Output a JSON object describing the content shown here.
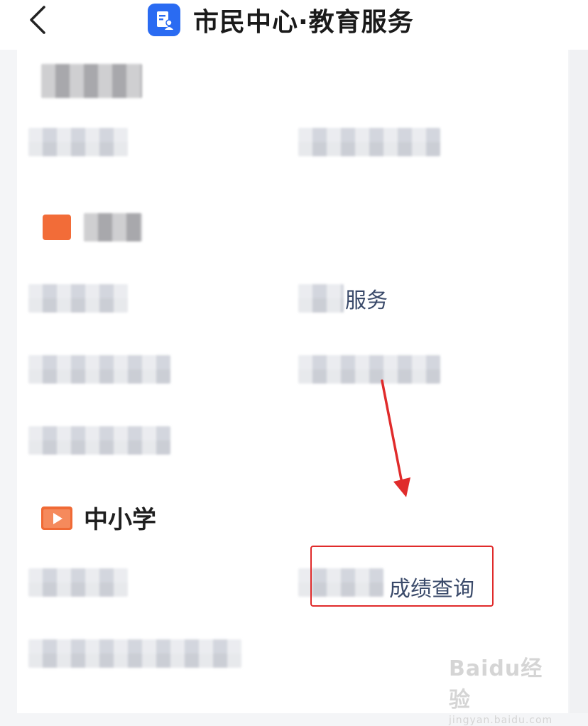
{
  "header": {
    "title": "市民中心·教育服务",
    "back_icon": "chevron-left-icon",
    "app_icon": "document-person-icon",
    "app_icon_color": "#2a6bf2"
  },
  "sections": {
    "section3": {
      "title": "中小学",
      "icon": "play-screen-icon",
      "icon_color": "#f06a35"
    }
  },
  "items": {
    "partial_service": "服务",
    "score_query": "成绩查询"
  },
  "highlight_color": "#e02b2b",
  "watermark": {
    "main": "Baidu经验",
    "sub": "jingyan.baidu.com"
  }
}
